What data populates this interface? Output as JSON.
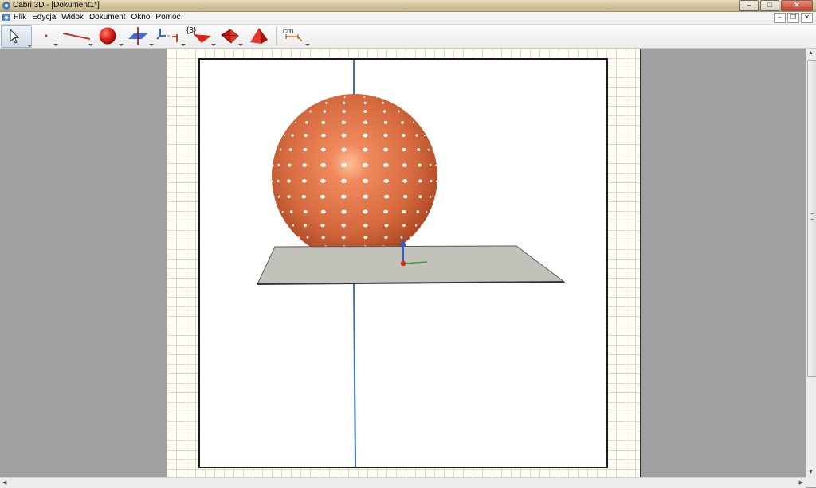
{
  "window": {
    "title": "Cabri 3D - [Dokument1*]",
    "controls": {
      "minimize": "–",
      "maximize": "□",
      "close": "✕"
    }
  },
  "menubar": {
    "items": [
      "Plik",
      "Edycja",
      "Widok",
      "Dokument",
      "Okno",
      "Pomoc"
    ],
    "mdi_controls": {
      "minimize": "–",
      "restore": "❐",
      "close": "✕"
    }
  },
  "toolbar": {
    "tools": [
      {
        "icon": "pointer-icon"
      },
      {
        "icon": "point-icon"
      },
      {
        "icon": "line-icon"
      },
      {
        "icon": "sphere-icon"
      },
      {
        "icon": "perpendicular-plane-icon"
      },
      {
        "icon": "transformation-icon"
      },
      {
        "icon": "regular-polygon-icon",
        "label": "{3}"
      },
      {
        "icon": "tetrahedron-icon"
      },
      {
        "icon": "pyramid-icon"
      },
      {
        "icon": "measurement-icon",
        "label": "cm"
      }
    ]
  },
  "colors": {
    "sphere": "#d4693d",
    "plane": "#c0c0b8",
    "axis": "#3b6fb5",
    "page_grid": "#dcdcc8",
    "workspace": "#a0a0a0"
  },
  "scrollbars": {
    "v_up": "▲",
    "v_down": "▼",
    "h_left": "◀",
    "h_right": "▶"
  }
}
